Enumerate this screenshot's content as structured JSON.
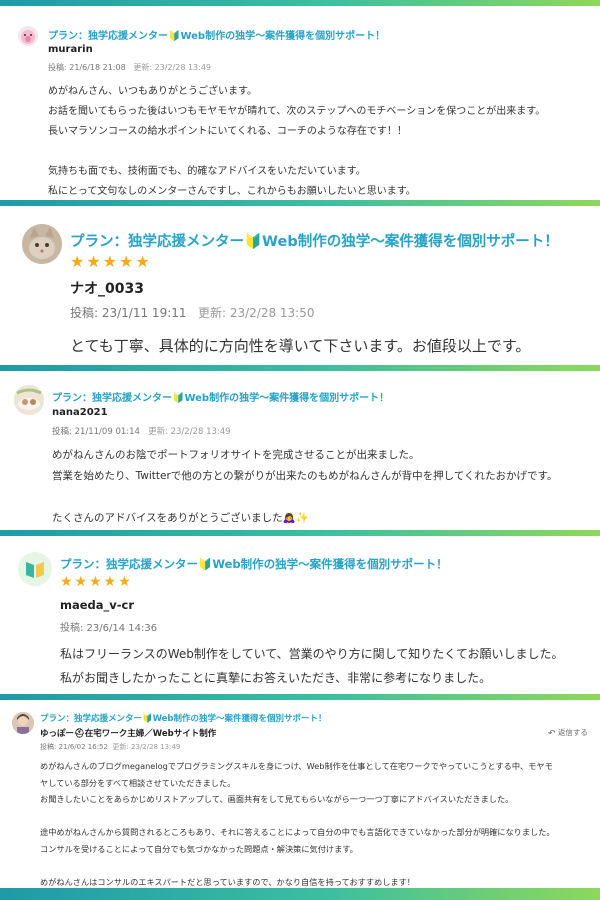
{
  "colors": {
    "accent": "#27a3c7",
    "star": "#f5a91b",
    "bar_start": "#1e9aa8",
    "bar_end": "#8ed85a"
  },
  "reviews": [
    {
      "plan": "プラン：独学応援メンター🔰Web制作の独学〜案件獲得を個別サポート！",
      "user": "murarin",
      "posted": "投稿: 21/6/18 21:08",
      "updated": "更新: 23/2/28 13:49",
      "avatar_icon": "pig-avatar-icon",
      "lines": [
        "めがねんさん、いつもありがとうございます。",
        "お話を聞いてもらった後はいつもモヤモヤが晴れて、次のステップへのモチベーションを保つことが出来ます。",
        "長いマラソンコースの給水ポイントにいてくれる、コーチのような存在です！！",
        "",
        "気持ちも面でも、技術面でも、的確なアドバイスをいただいています。",
        "私にとって文句なしのメンターさんですし、これからもお願いしたいと思います。"
      ]
    },
    {
      "plan": "プラン：独学応援メンター🔰Web制作の独学〜案件獲得を個別サポート！",
      "stars": "★★★★★",
      "rating": 5,
      "user": "ナオ_0033",
      "posted": "投稿: 23/1/11 19:11",
      "updated": "更新: 23/2/28 13:50",
      "avatar_icon": "cat-avatar-icon",
      "lines": [
        "とても丁寧、具体的に方向性を導いて下さいます。お値段以上です。"
      ]
    },
    {
      "plan": "プラン：独学応援メンター🔰Web制作の独学〜案件獲得を個別サポート！",
      "user": "nana2021",
      "posted": "投稿: 21/11/09 01:14",
      "updated": "更新: 23/2/28 13:49",
      "avatar_icon": "photo-avatar-icon",
      "lines": [
        "めがねんさんのお陰でポートフォリオサイトを完成させることが出来ました。",
        "営業を始めたり、Twitterで他の方との繋がりが出来たのもめがねんさんが背中を押してくれたおかげです。",
        "",
        "たくさんのアドバイスをありがとうございました🙇‍♀️✨"
      ]
    },
    {
      "plan": "プラン：独学応援メンター🔰Web制作の独学〜案件獲得を個別サポート！",
      "stars": "★★★★★",
      "rating": 5,
      "user": "maeda_v-cr",
      "posted": "投稿: 23/6/14 14:36",
      "avatar_icon": "book-avatar-icon",
      "lines": [
        "私はフリーランスのWeb制作をしていて、営業のやり方に関して知りたくてお願いしました。",
        "私がお聞きしたかったことに真摯にお答えいただき、非常に参考になりました。"
      ]
    },
    {
      "plan": "プラン：独学応援メンター🔰Web制作の独学〜案件獲得を個別サポート！",
      "user": "ゆっぽー⛑在宅ワーク主婦／Webサイト制作",
      "posted": "投稿: 21/6/02 16:52",
      "updated": "更新: 23/2/28 13:49",
      "reply": "返信する",
      "avatar_icon": "woman-avatar-icon",
      "lines": [
        "めがねんさんのブログmeganelogでプログラミングスキルを身につけ、Web制作を仕事として在宅ワークでやっていこうとする中、モヤモ",
        "ヤしている部分をすべて相談させていただきました。",
        "お聞きしたいことをあらかじめリストアップして、画面共有をして見てもらいながら一つ一つ丁寧にアドバイスいただきました。",
        "",
        "途中めがねんさんから質問されるところもあり、それに答えることによって自分の中でも言語化できていなかった部分が明確になりました。",
        "コンサルを受けることによって自分でも気づかなかった問題点・解決策に気付けます。",
        "",
        "めがねんさんはコンサルのエキスパートだと思っていますので、かなり自信を持っておすすめします！"
      ]
    }
  ]
}
